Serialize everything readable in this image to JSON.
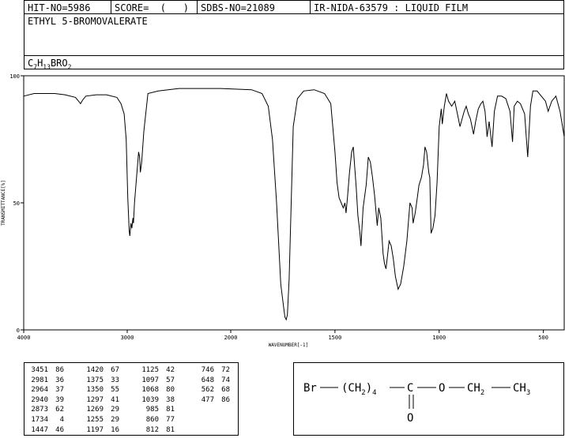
{
  "header": {
    "hit_no": "HIT-NO=5986",
    "score": "SCORE=  (   )",
    "sdbs_no": "SDBS-NO=21089",
    "ir_nida": "IR-NIDA-63579 : LIQUID FILM"
  },
  "compound_name": "ETHYL 5-BROMOVALERATE",
  "formula": {
    "c": "C",
    "c_sub": "7",
    "h": "H",
    "h_sub": "13",
    "rest": "BRO",
    "o_sub": "2"
  },
  "chart_data": {
    "type": "line",
    "title": "",
    "xlabel": "WAVENUMBER[-1]",
    "ylabel": "TRANSMITTANCE[%]",
    "xlim": [
      4000,
      400
    ],
    "ylim": [
      0,
      100
    ],
    "xticks": [
      "4000",
      "3000",
      "2000",
      "1500",
      "1000",
      "500"
    ],
    "yticks": [
      "100",
      "50",
      "0"
    ],
    "series": [
      {
        "x": [
          4000,
          3900,
          3800,
          3700,
          3600,
          3500,
          3470,
          3451,
          3430,
          3400,
          3300,
          3200,
          3100,
          3060,
          3030,
          3010,
          2995,
          2981,
          2975,
          2964,
          2955,
          2945,
          2940,
          2930,
          2910,
          2890,
          2880,
          2873,
          2860,
          2840,
          2800,
          2700,
          2500,
          2300,
          2100,
          1900,
          1850,
          1820,
          1800,
          1780,
          1760,
          1745,
          1740,
          1734,
          1728,
          1720,
          1710,
          1700,
          1680,
          1650,
          1600,
          1550,
          1520,
          1500,
          1490,
          1480,
          1470,
          1460,
          1452,
          1447,
          1440,
          1430,
          1420,
          1412,
          1405,
          1398,
          1390,
          1380,
          1375,
          1365,
          1350,
          1340,
          1330,
          1320,
          1310,
          1297,
          1290,
          1280,
          1269,
          1262,
          1255,
          1248,
          1240,
          1230,
          1220,
          1210,
          1197,
          1185,
          1170,
          1155,
          1140,
          1130,
          1125,
          1115,
          1105,
          1097,
          1085,
          1075,
          1068,
          1060,
          1050,
          1045,
          1039,
          1030,
          1020,
          1010,
          1000,
          990,
          985,
          975,
          965,
          955,
          940,
          925,
          910,
          900,
          880,
          870,
          860,
          850,
          835,
          825,
          812,
          800,
          790,
          780,
          770,
          760,
          746,
          735,
          720,
          700,
          680,
          660,
          648,
          640,
          625,
          610,
          590,
          575,
          562,
          550,
          530,
          510,
          490,
          477,
          460,
          440,
          420,
          400
        ],
        "y": [
          92,
          93,
          93,
          93,
          92.5,
          91.5,
          90,
          89,
          90.5,
          92,
          92.5,
          92.5,
          91.5,
          89,
          85,
          75,
          52,
          39,
          37,
          42,
          40,
          44,
          42,
          50,
          60,
          70,
          68,
          62,
          66,
          78,
          93,
          94,
          95,
          95,
          95,
          94.5,
          93,
          88,
          75,
          50,
          18,
          8,
          5,
          4,
          6,
          20,
          50,
          80,
          91,
          94,
          94.5,
          93,
          89,
          70,
          58,
          52,
          50,
          48,
          50,
          46,
          52,
          62,
          70,
          72,
          64,
          56,
          45,
          38,
          33,
          48,
          57,
          68,
          66,
          60,
          53,
          41,
          48,
          44,
          30,
          26,
          24,
          29,
          35,
          33,
          28,
          21,
          16,
          18,
          25,
          35,
          50,
          48,
          42,
          46,
          52,
          57,
          60,
          65,
          72,
          70,
          62,
          60,
          38,
          40,
          45,
          58,
          80,
          87,
          81,
          88,
          93,
          90,
          88,
          90,
          84,
          80,
          86,
          88,
          85,
          83,
          77,
          82,
          87,
          89,
          90,
          86,
          76,
          82,
          72,
          86,
          92,
          92,
          91,
          86,
          74,
          88,
          90,
          89,
          85,
          68,
          88,
          94,
          94,
          92,
          90,
          86,
          90,
          92,
          86,
          76
        ]
      }
    ],
    "grid": false,
    "legend": "none"
  },
  "peak_table": {
    "columns": [
      {
        "rows": [
          [
            "3451",
            "86"
          ],
          [
            "2981",
            "36"
          ],
          [
            "2964",
            "37"
          ],
          [
            "2940",
            "39"
          ],
          [
            "2873",
            "62"
          ],
          [
            "1734",
            "4"
          ],
          [
            "1447",
            "46"
          ]
        ]
      },
      {
        "rows": [
          [
            "1420",
            "67"
          ],
          [
            "1375",
            "33"
          ],
          [
            "1350",
            "55"
          ],
          [
            "1297",
            "41"
          ],
          [
            "1269",
            "29"
          ],
          [
            "1255",
            "29"
          ],
          [
            "1197",
            "16"
          ]
        ]
      },
      {
        "rows": [
          [
            "1125",
            "42"
          ],
          [
            "1097",
            "57"
          ],
          [
            "1068",
            "80"
          ],
          [
            "1039",
            "38"
          ],
          [
            "985",
            "81"
          ],
          [
            "860",
            "77"
          ],
          [
            "812",
            "81"
          ]
        ]
      },
      {
        "rows": [
          [
            "746",
            "72"
          ],
          [
            "648",
            "74"
          ],
          [
            "562",
            "68"
          ],
          [
            "477",
            "86"
          ]
        ]
      }
    ]
  },
  "structure": {
    "br": "Br",
    "ch2_open": "(CH",
    "ch2_sub": "2",
    "ch2_close": ")",
    "count": "4",
    "c": "C",
    "o_ester": "O",
    "ch2": "CH",
    "ch2b_sub": "2",
    "ch3": "CH",
    "ch3_sub": "3",
    "o_carbonyl": "O"
  }
}
